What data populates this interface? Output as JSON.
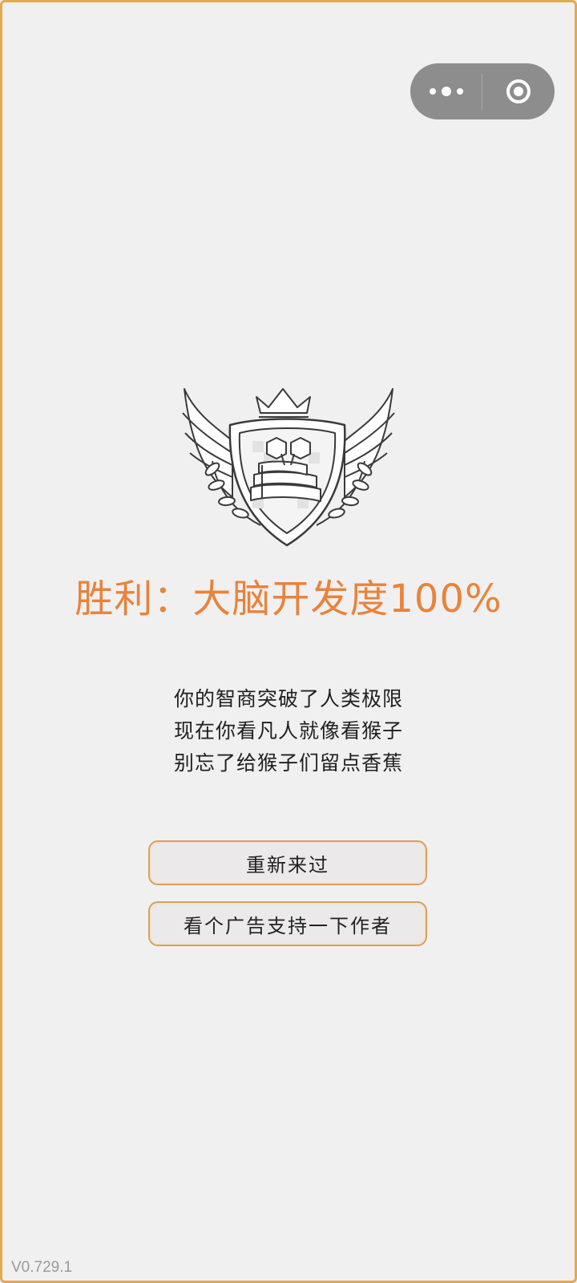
{
  "capsule": {
    "more_icon": "more-dots-icon",
    "close_icon": "target-close-icon"
  },
  "badge": {
    "icon": "winged-shield-crown-books-emblem"
  },
  "result": {
    "title": "胜利：大脑开发度100%",
    "lines": [
      "你的智商突破了人类极限",
      "现在你看凡人就像看猴子",
      "别忘了给猴子们留点香蕉"
    ]
  },
  "buttons": {
    "restart": "重新来过",
    "watch_ad": "看个广告支持一下作者"
  },
  "version": "V0.729.1",
  "colors": {
    "accent": "#e8833b",
    "frame": "#e3aa4d",
    "button_border": "#d2a263",
    "background": "#f1f0f0"
  }
}
